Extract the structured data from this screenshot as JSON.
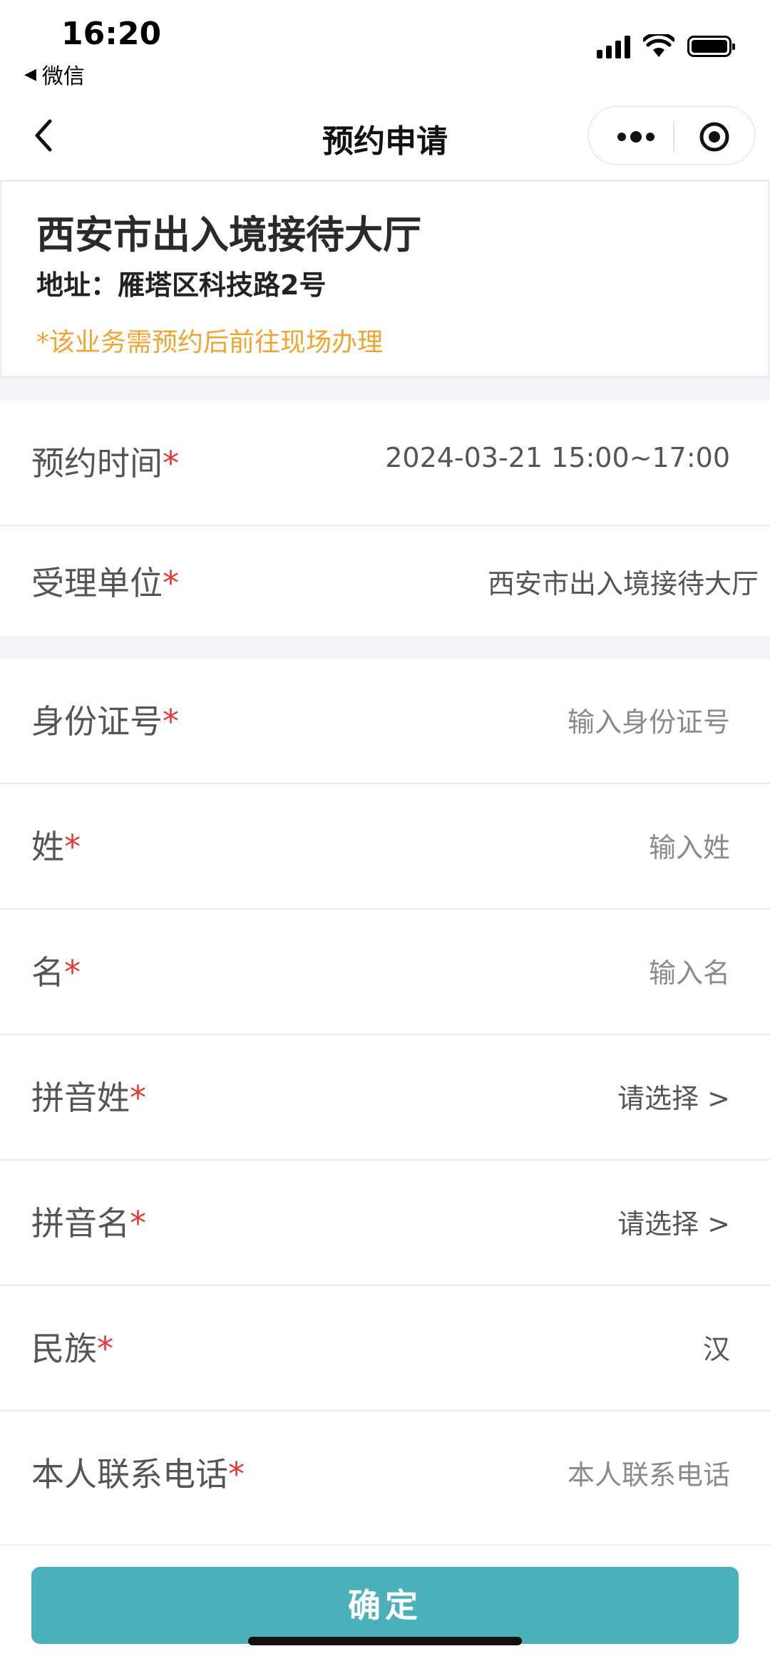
{
  "status_bar": {
    "time": "16:20",
    "back_app": "微信",
    "back_arrow": "◀"
  },
  "nav": {
    "title": "预约申请",
    "back_icon": "chevron-left-icon",
    "more_icon": "more-dots-icon",
    "close_icon": "record-circle-icon"
  },
  "header_card": {
    "title": "西安市出入境接待大厅",
    "address": "地址：雁塔区科技路2号",
    "notice": "*该业务需预约后前往现场办理"
  },
  "form": {
    "required_mark": "*",
    "appointment_time": {
      "label": "预约时间",
      "value": "2024-03-21 15:00~17:00"
    },
    "accepting_unit": {
      "label": "受理单位",
      "value": "西安市出入境接待大厅"
    },
    "id_number": {
      "label": "身份证号",
      "placeholder": "输入身份证号"
    },
    "surname": {
      "label": "姓",
      "placeholder": "输入姓"
    },
    "given_name": {
      "label": "名",
      "placeholder": "输入名"
    },
    "pinyin_surname": {
      "label": "拼音姓",
      "value": "请选择 >"
    },
    "pinyin_given_name": {
      "label": "拼音名",
      "value": "请选择 >"
    },
    "ethnicity": {
      "label": "民族",
      "value": "汉"
    },
    "phone": {
      "label": "本人联系电话",
      "placeholder": "本人联系电话"
    }
  },
  "footer": {
    "confirm_label": "确定"
  },
  "colors": {
    "accent": "#4cb0bb",
    "notice": "#f0a432",
    "required": "#e53935",
    "section_gap": "#f3f5f8"
  }
}
